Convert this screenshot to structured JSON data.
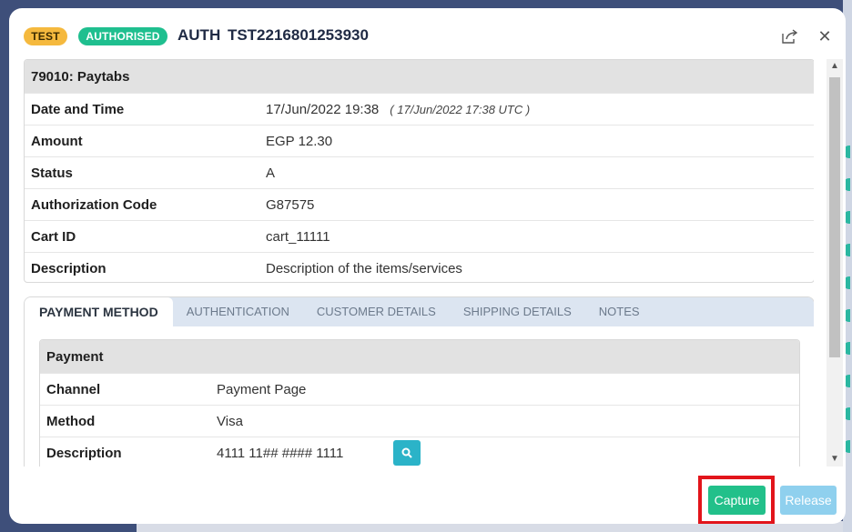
{
  "header": {
    "badge_test": "TEST",
    "badge_status": "AUTHORISED",
    "title": "AUTH  TST2216801253930",
    "share_icon": "share-icon",
    "close_icon": "close-icon"
  },
  "summary": {
    "heading": "79010: Paytabs",
    "rows": [
      {
        "label": "Date and Time",
        "value": "17/Jun/2022 19:38",
        "extra": "( 17/Jun/2022 17:38 UTC )"
      },
      {
        "label": "Amount",
        "value": "EGP 12.30"
      },
      {
        "label": "Status",
        "value": "A"
      },
      {
        "label": "Authorization Code",
        "value": "G87575"
      },
      {
        "label": "Cart ID",
        "value": "cart_11111"
      },
      {
        "label": "Description",
        "value": "Description of the items/services"
      }
    ]
  },
  "tabs": [
    {
      "label": "PAYMENT METHOD",
      "active": true
    },
    {
      "label": "AUTHENTICATION",
      "active": false
    },
    {
      "label": "CUSTOMER DETAILS",
      "active": false
    },
    {
      "label": "SHIPPING DETAILS",
      "active": false
    },
    {
      "label": "NOTES",
      "active": false
    }
  ],
  "payment": {
    "heading": "Payment",
    "rows": [
      {
        "label": "Channel",
        "value": "Payment Page"
      },
      {
        "label": "Method",
        "value": "Visa"
      },
      {
        "label": "Description",
        "value": "4111 11## #### 1111"
      }
    ]
  },
  "footer": {
    "capture_label": "Capture",
    "release_label": "Release"
  },
  "colors": {
    "test_badge": "#f5b93e",
    "authorised_badge": "#1fbf8f",
    "capture_button": "#22c08a",
    "release_button": "#8fd0ee",
    "highlight": "#e2151b"
  }
}
